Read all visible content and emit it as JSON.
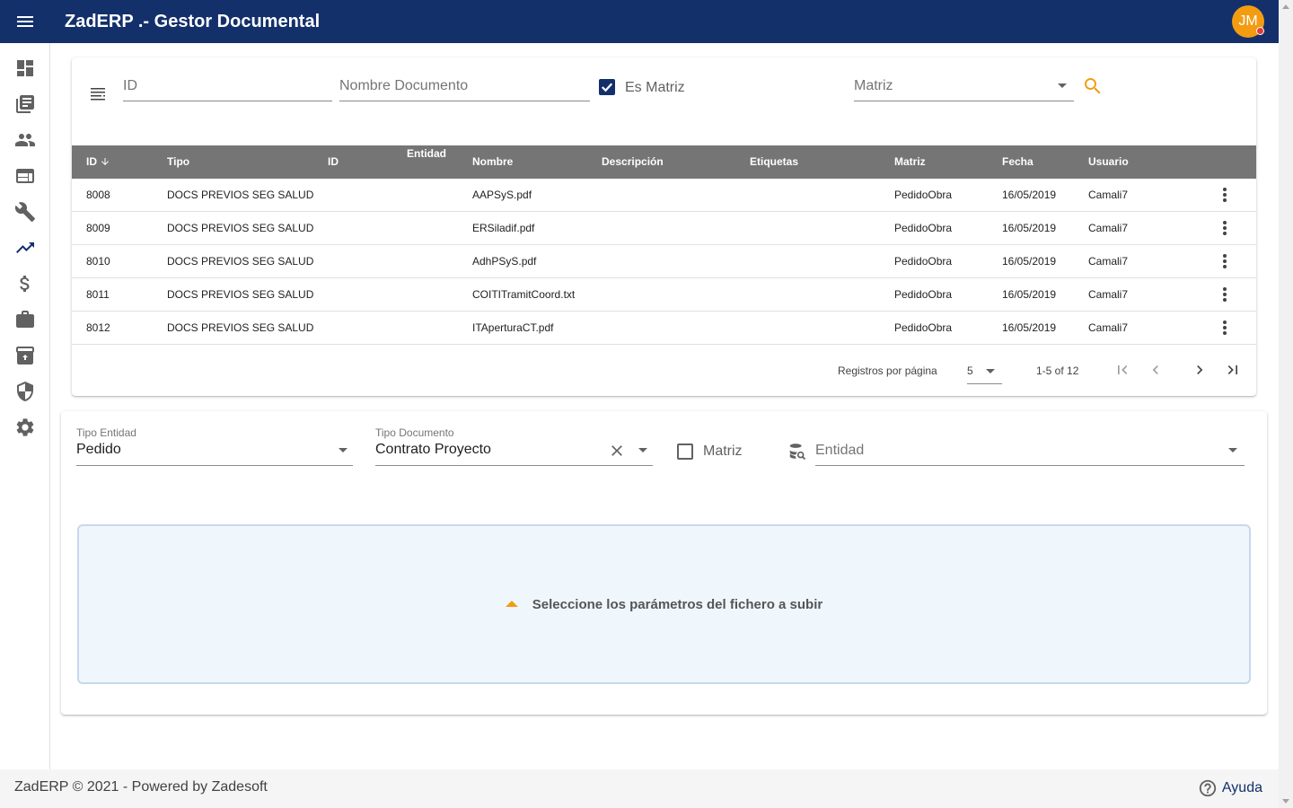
{
  "app": {
    "title": "ZadERP .- Gestor Documental",
    "user_initials": "JM"
  },
  "colors": {
    "primary": "#13306b",
    "accent": "#f39c12",
    "table_header": "#757575",
    "dropzone_bg": "#f0f7fc"
  },
  "sidebar": {
    "items": [
      {
        "icon": "dashboard-icon"
      },
      {
        "icon": "library-books-icon"
      },
      {
        "icon": "people-icon"
      },
      {
        "icon": "web-window-icon"
      },
      {
        "icon": "wrench-icon"
      },
      {
        "icon": "trending-up-icon"
      },
      {
        "icon": "dollar-icon"
      },
      {
        "icon": "briefcase-icon"
      },
      {
        "icon": "archive-upload-icon"
      },
      {
        "icon": "shield-icon"
      },
      {
        "icon": "gear-icon"
      }
    ]
  },
  "filters": {
    "id_placeholder": "ID",
    "nombre_placeholder": "Nombre Documento",
    "es_matriz_label": "Es Matriz",
    "es_matriz_checked": true,
    "matriz_placeholder": "Matriz"
  },
  "table": {
    "headers": {
      "id": "ID",
      "tipo": "Tipo",
      "id2": "ID",
      "entidad": "Entidad",
      "nombre": "Nombre",
      "descripcion": "Descripción",
      "etiquetas": "Etiquetas",
      "matriz": "Matriz",
      "fecha": "Fecha",
      "usuario": "Usuario"
    },
    "sort_icon": "arrow-down-icon",
    "rows": [
      {
        "id": "8008",
        "tipo": "DOCS PREVIOS SEG SALUD",
        "nombre": "AAPSyS.pdf",
        "matriz": "PedidoObra",
        "fecha": "16/05/2019",
        "usuario": "Camali7"
      },
      {
        "id": "8009",
        "tipo": "DOCS PREVIOS SEG SALUD",
        "nombre": "ERSiladif.pdf",
        "matriz": "PedidoObra",
        "fecha": "16/05/2019",
        "usuario": "Camali7"
      },
      {
        "id": "8010",
        "tipo": "DOCS PREVIOS SEG SALUD",
        "nombre": "AdhPSyS.pdf",
        "matriz": "PedidoObra",
        "fecha": "16/05/2019",
        "usuario": "Camali7"
      },
      {
        "id": "8011",
        "tipo": "DOCS PREVIOS SEG SALUD",
        "nombre": "COITITramitCoord.txt",
        "matriz": "PedidoObra",
        "fecha": "16/05/2019",
        "usuario": "Camali7"
      },
      {
        "id": "8012",
        "tipo": "DOCS PREVIOS SEG SALUD",
        "nombre": "ITAperturaCT.pdf",
        "matriz": "PedidoObra",
        "fecha": "16/05/2019",
        "usuario": "Camali7"
      }
    ]
  },
  "paginator": {
    "label": "Registros por página",
    "page_size": "5",
    "range": "1-5 of 12"
  },
  "upload": {
    "tipo_entidad_label": "Tipo Entidad",
    "tipo_entidad_value": "Pedido",
    "tipo_documento_label": "Tipo Documento",
    "tipo_documento_value": "Contrato Proyecto",
    "matriz_label": "Matriz",
    "matriz_checked": false,
    "entidad_placeholder": "Entidad",
    "dropzone_message": "Seleccione los parámetros del fichero a subir"
  },
  "footer": {
    "text": "ZadERP © 2021 - Powered by Zadesoft",
    "help_label": "Ayuda"
  }
}
